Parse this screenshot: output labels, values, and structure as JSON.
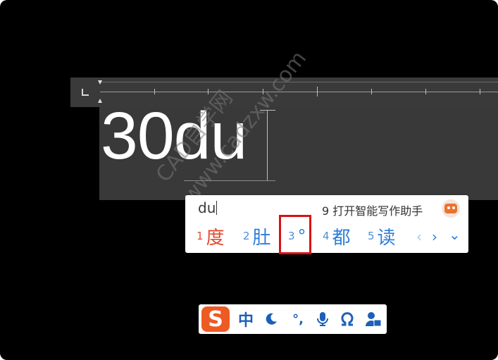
{
  "editor": {
    "mtext_content": "30du"
  },
  "watermark": {
    "line1": "CAD自学网",
    "line2": "www.cadzxw.com"
  },
  "ime": {
    "input": "du",
    "assist_label": "9 打开智能写作助手",
    "candidates": [
      {
        "num": "1",
        "word": "度"
      },
      {
        "num": "2",
        "word": "肚"
      },
      {
        "num": "3",
        "word": "°"
      },
      {
        "num": "4",
        "word": "都"
      },
      {
        "num": "5",
        "word": "读"
      }
    ],
    "prev_glyph": "‹",
    "next_glyph": "›",
    "expand_glyph": "⌄"
  },
  "imebar": {
    "logo": "S",
    "lang": "中",
    "punct": "°,",
    "icons": [
      "moon-icon",
      "microphone-icon",
      "omega-icon",
      "user-icon"
    ]
  },
  "colors": {
    "highlight_box": "#d81313",
    "candidate_blue": "#2f7ed8",
    "first_candidate": "#e44a2f",
    "ime_logo": "#ee5a24"
  }
}
